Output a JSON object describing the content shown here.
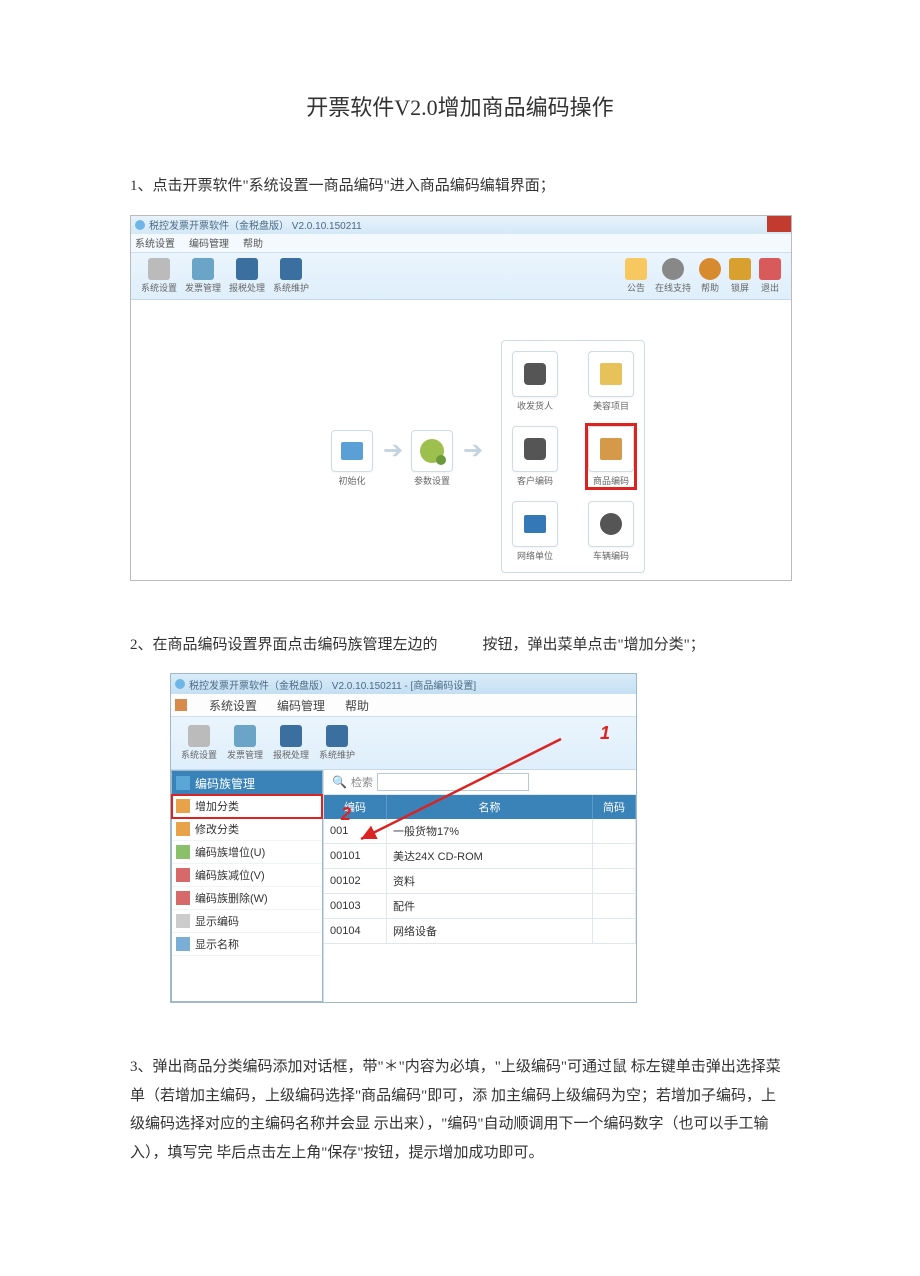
{
  "title": "开票软件V2.0增加商品编码操作",
  "steps": {
    "s1": "1、点击开票软件\"系统设置一商品编码\"进入商品编码编辑界面；",
    "s2a": "2、在商品编码设置界面点击编码族管理左边的",
    "s2b": "按钮，弹出菜单点击\"增加分类\"；",
    "s3": "3、弹出商品分类编码添加对话框，带\"＊\"内容为必填，\"上级编码\"可通过鼠 标左键单击弹出选择菜单（若增加主编码，上级编码选择\"商品编码\"即可，添 加主编码上级编码为空；若增加子编码，上级编码选择对应的主编码名称并会显 示出来），\"编码\"自动顺调用下一个编码数字（也可以手工输入），填写完 毕后点击左上角\"保存\"按钮，提示增加成功即可。"
  },
  "shot1": {
    "titlebar": "税控发票开票软件（金税盘版） V2.0.10.150211",
    "menus": [
      "系统设置",
      "编码管理",
      "帮助"
    ],
    "toolbar_left": [
      "系统设置",
      "发票管理",
      "报税处理",
      "系统维护"
    ],
    "toolbar_right": [
      "公告",
      "在线支持",
      "帮助",
      "锁屏",
      "退出"
    ],
    "flow": {
      "init": "初始化",
      "param": "参数设置"
    },
    "grid": [
      "收发货人",
      "美容项目",
      "客户编码",
      "商品编码",
      "网络单位",
      "车辆编码"
    ]
  },
  "shot2": {
    "titlebar": "税控发票开票软件（金税盘版） V2.0.10.150211 - [商品编码设置]",
    "menus": [
      "系统设置",
      "编码管理",
      "帮助"
    ],
    "toolbar": [
      "系统设置",
      "发票管理",
      "报税处理",
      "系统维护"
    ],
    "menupanel": {
      "header": "编码族管理",
      "items": [
        "增加分类",
        "修改分类",
        "编码族增位(U)",
        "编码族减位(V)",
        "编码族删除(W)",
        "显示编码",
        "显示名称"
      ]
    },
    "search_label": "检索",
    "table": {
      "headers": [
        "编码",
        "名称",
        "简码"
      ],
      "rows": [
        {
          "code": "001",
          "name": "一般货物17%"
        },
        {
          "code": "00101",
          "name": "美达24X CD-ROM"
        },
        {
          "code": "00102",
          "name": "资料"
        },
        {
          "code": "00103",
          "name": "配件"
        },
        {
          "code": "00104",
          "name": "网络设备"
        }
      ]
    },
    "marker1": "1",
    "marker2": "2"
  }
}
